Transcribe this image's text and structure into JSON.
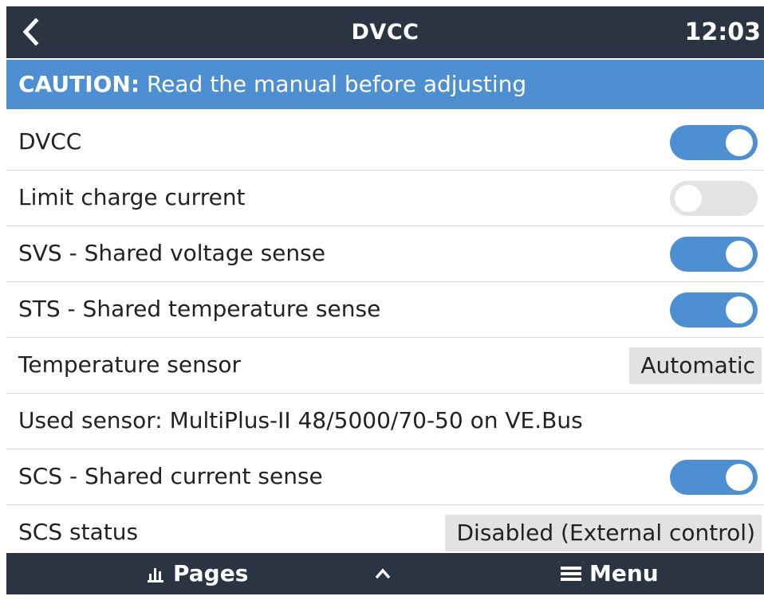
{
  "header": {
    "title": "DVCC",
    "clock": "12:03"
  },
  "caution": {
    "prefix": "CAUTION:",
    "text": "Read the manual before adjusting"
  },
  "rows": [
    {
      "label": "DVCC",
      "type": "toggle",
      "enabled": true
    },
    {
      "label": "Limit charge current",
      "type": "toggle",
      "enabled": false
    },
    {
      "label": "SVS - Shared voltage sense",
      "type": "toggle",
      "enabled": true
    },
    {
      "label": "STS - Shared temperature sense",
      "type": "toggle",
      "enabled": true
    },
    {
      "label": "Temperature sensor",
      "type": "value",
      "value": "Automatic"
    },
    {
      "label": "Used sensor: MultiPlus-II 48/5000/70-50 on VE.Bus",
      "type": "text"
    },
    {
      "label": "SCS - Shared current sense",
      "type": "toggle",
      "enabled": true
    },
    {
      "label": "SCS status",
      "type": "value",
      "value": "Disabled (External control)"
    }
  ],
  "footer": {
    "pages_label": "Pages",
    "menu_label": "Menu",
    "pages_icon": "bar-chart-icon",
    "up_icon": "chevron-up-icon",
    "menu_icon": "hamburger-menu-icon"
  },
  "colors": {
    "header_bg": "#2a3443",
    "accent": "#4d8fd0",
    "toggle_off": "#e3e3e3",
    "value_box_bg": "#e2e2e2"
  }
}
